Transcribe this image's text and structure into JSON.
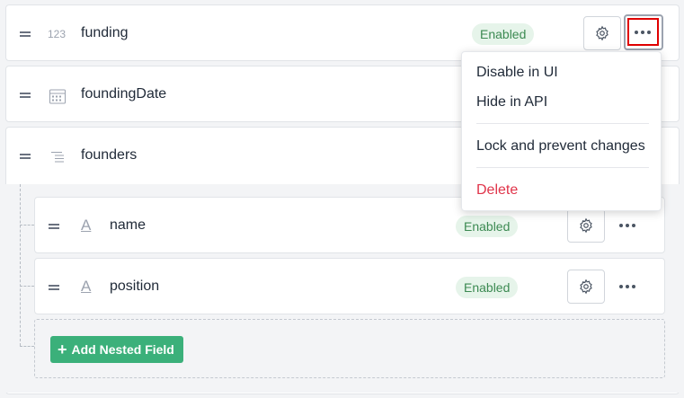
{
  "fields": [
    {
      "name": "funding",
      "status": "Enabled",
      "type_icon": "number-type-icon",
      "type_glyph": "123"
    },
    {
      "name": "foundingDate",
      "type_icon": "calendar-icon"
    },
    {
      "name": "founders",
      "type_icon": "list-type-icon"
    }
  ],
  "nested_fields": [
    {
      "name": "name",
      "status": "Enabled",
      "type_icon": "text-type-icon",
      "type_glyph": "A"
    },
    {
      "name": "position",
      "status": "Enabled",
      "type_icon": "text-type-icon",
      "type_glyph": "A"
    }
  ],
  "menu": {
    "items": [
      "Disable in UI",
      "Hide in API",
      "Lock and prevent changes",
      "Delete"
    ],
    "danger_color": "#e0344a"
  },
  "add_nested_label": "Add Nested Field",
  "colors": {
    "accent": "#3bb07a",
    "badge_text": "#3c8a52",
    "badge_bg": "#e6f4ea"
  }
}
